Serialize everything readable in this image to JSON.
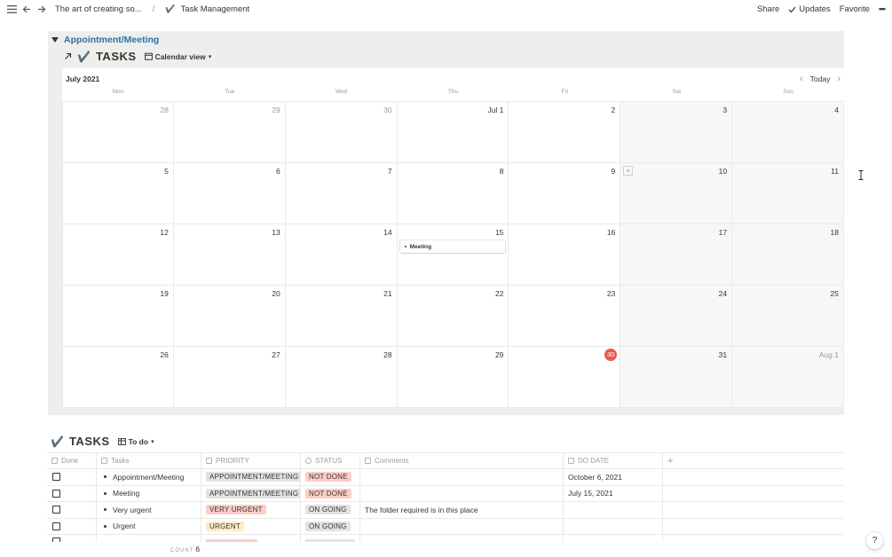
{
  "topbar": {
    "breadcrumb_parent": "The art of creating so...",
    "breadcrumb_sep": "/",
    "page_icon": "✔️",
    "page_title": "Task Management",
    "share": "Share",
    "updates": "Updates",
    "favorite": "Favorite",
    "more": "•••"
  },
  "toggle": {
    "title": "Appointment/Meeting"
  },
  "calendar_db": {
    "title": "TASKS",
    "view_label": "Calendar view",
    "month": "July 2021",
    "today": "Today",
    "weekdays": [
      "Mon",
      "Tue",
      "Wed",
      "Thu",
      "Fri",
      "Sat",
      "Sun"
    ],
    "days": [
      "28",
      "29",
      "30",
      "Jul 1",
      "2",
      "3",
      "4",
      "5",
      "6",
      "7",
      "8",
      "9",
      "10",
      "11",
      "12",
      "13",
      "14",
      "15",
      "16",
      "17",
      "18",
      "19",
      "20",
      "21",
      "22",
      "23",
      "24",
      "25",
      "26",
      "27",
      "28",
      "29",
      "30",
      "31",
      "Aug 1"
    ],
    "event": "Meeting"
  },
  "table_db": {
    "title": "TASKS",
    "view_label": "To do",
    "columns": {
      "done": "Done",
      "tasks": "Tasks",
      "priority": "PRIORITY",
      "status": "STATUS",
      "comments": "Comments",
      "do_date": "DO DATE",
      "add": "+"
    },
    "rows": [
      {
        "task": "Appointment/Meeting",
        "priority": "APPOINTMENT/MEETING",
        "status": "NOT DONE",
        "comments": "",
        "date": "October 6, 2021"
      },
      {
        "task": "Meeting",
        "priority": "APPOINTMENT/MEETING",
        "status": "NOT DONE",
        "comments": "",
        "date": "July 15, 2021"
      },
      {
        "task": "Very urgent",
        "priority": "VERY URGENT",
        "status": "ON GOING",
        "comments": "The folder required is in this place",
        "date": ""
      },
      {
        "task": "Urgent",
        "priority": "URGENT",
        "status": "ON GOING",
        "comments": "",
        "date": ""
      }
    ],
    "count_label": "COUNT",
    "count_value": "6"
  },
  "colors": {
    "appointment": "#e3e2e0",
    "not_done": "#ffccc7",
    "very_urgent": "#ffccc7",
    "urgent": "#fdecc8",
    "on_going": "#e3e2e0",
    "link": "#2e6fa7",
    "today_circle": "#eb5757"
  },
  "help": "?"
}
